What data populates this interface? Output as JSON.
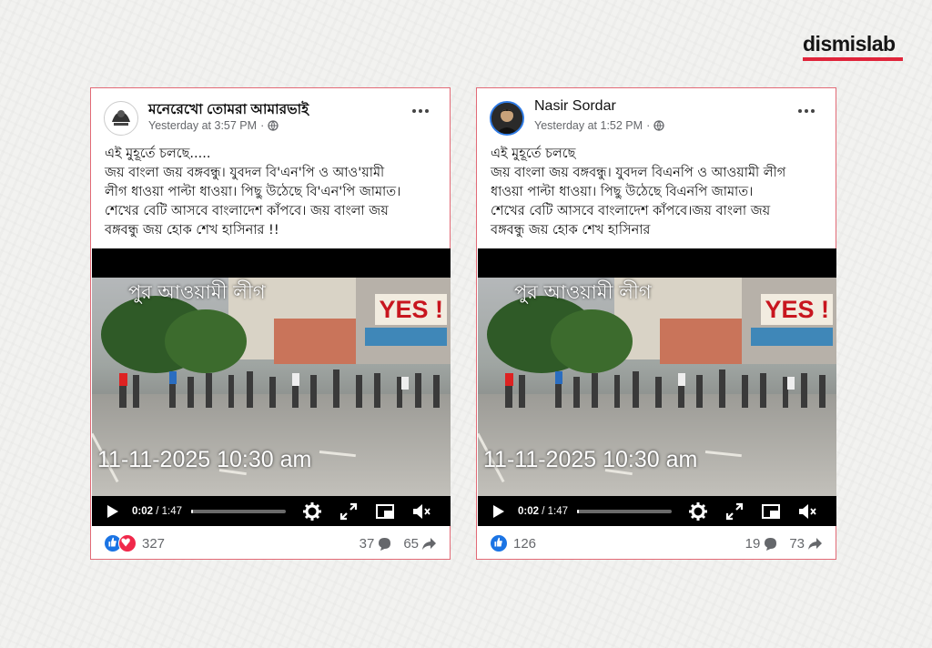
{
  "brand": {
    "name": "dismislab",
    "color": "#e0243a"
  },
  "posts": [
    {
      "author": "মনেরেখো তোমরা আমারভাই",
      "timestamp": "Yesterday at 3:57 PM",
      "separator": "·",
      "privacy_icon": "globe-icon",
      "text_lines": [
        "এই মুহূর্তে চলছে.....",
        "জয় বাংলা জয় বঙ্গবন্ধু। যুবদল বি'এন'পি ও আও'য়ামী",
        "লীগ ধাওয়া পাল্টা ধাওয়া। পিছু উঠেছে বি'এন'পি জামাত।",
        "শেখের বেটি আসবে বাংলাদেশ কাঁপবে। জয় বাংলা জয়",
        "বঙ্গবন্ধু জয় হোক শেখ হাসিনার !!"
      ],
      "video": {
        "overlay_text": "পুর আওয়ামী লীগ",
        "sign_text": "YES !",
        "date_stamp": "11-11-2025 10:30 am",
        "current_time": "0:02",
        "duration": "/ 1:47",
        "progress": 0.02
      },
      "reactions": [
        "like",
        "love"
      ],
      "reaction_count": "327",
      "comment_count": "37",
      "share_count": "65"
    },
    {
      "author": "Nasir Sordar",
      "timestamp": "Yesterday at 1:52 PM",
      "separator": "·",
      "privacy_icon": "globe-icon",
      "text_lines": [
        "এই মুহূর্তে চলছে",
        "জয় বাংলা জয় বঙ্গবন্ধু। যুবদল বিএনপি ও আওয়ামী লীগ",
        "ধাওয়া পাল্টা ধাওয়া। পিছু উঠেছে বিএনপি জামাত।",
        "শেখের বেটি আসবে বাংলাদেশ কাঁপবে।জয় বাংলা জয়",
        "বঙ্গবন্ধু জয় হোক শেখ হাসিনার"
      ],
      "video": {
        "overlay_text": "পুর আওয়ামী লীগ",
        "sign_text": "YES !",
        "date_stamp": "11-11-2025 10:30 am",
        "current_time": "0:02",
        "duration": "/ 1:47",
        "progress": 0.02
      },
      "reactions": [
        "like"
      ],
      "reaction_count": "126",
      "comment_count": "19",
      "share_count": "73"
    }
  ],
  "colors": {
    "card_border": "#e26a76",
    "like_blue": "#1b74e4",
    "love_red": "#f0284a",
    "meta_gray": "#65676b"
  }
}
